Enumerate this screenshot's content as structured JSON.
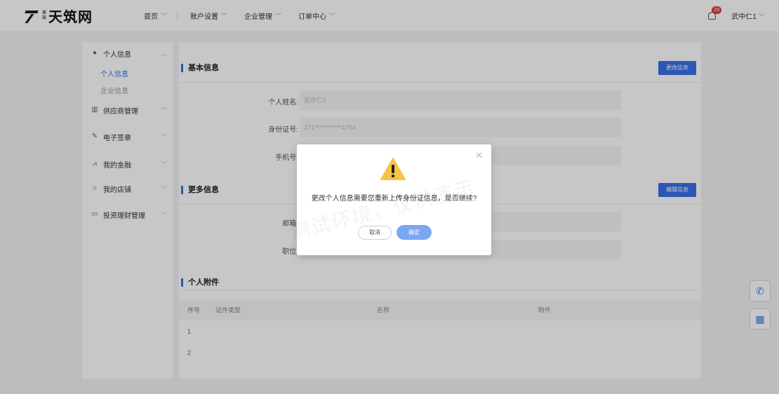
{
  "brand": {
    "logo_small_top": "天",
    "logo_small_bottom": "元",
    "name": "天筑网"
  },
  "nav": [
    {
      "label": "首页",
      "has_menu": true
    },
    {
      "label": "账户设置",
      "has_menu": true
    },
    {
      "label": "企业管理",
      "has_menu": true
    },
    {
      "label": "订单中心",
      "has_menu": true
    }
  ],
  "user": {
    "notification_count": "20",
    "name": "武中仁1"
  },
  "sidebar": {
    "personal_info": {
      "label": "个人信息",
      "icon": "user-icon",
      "expanded": true,
      "children": [
        {
          "label": "个人信息",
          "active": true
        },
        {
          "label": "企业信息",
          "active": false
        }
      ]
    },
    "groups": [
      {
        "label": "供应商管理",
        "icon": "bar-chart-icon"
      },
      {
        "label": "电子签章",
        "icon": "pen-icon"
      },
      {
        "label": "我的金融",
        "icon": "finance-chart-icon"
      },
      {
        "label": "我的店铺",
        "icon": "shop-icon"
      },
      {
        "label": "投资理财管理",
        "icon": "folder-icon"
      }
    ]
  },
  "basic": {
    "title": "基本信息",
    "edit_button": "更改信息",
    "name_label": "个人姓名:",
    "name_value": "武中仁1",
    "id_label": "身份证号:",
    "id_value": "371***********4754",
    "phone_label": "手机号:"
  },
  "more": {
    "title": "更多信息",
    "edit_button": "编辑信息",
    "email_label": "邮箱:",
    "position_label": "职位:"
  },
  "attachments": {
    "title": "个人附件",
    "columns": [
      "序号",
      "证件类型",
      "名称",
      "附件"
    ],
    "rows": [
      {
        "index": "1"
      },
      {
        "index": "2"
      }
    ]
  },
  "modal": {
    "message": "更改个人信息需要您重新上传身份证信息，是否继续?",
    "cancel": "取消",
    "confirm": "确定",
    "icon": "warning-icon",
    "warning_color": "#f6c443"
  },
  "watermark": "测试环境，仅供演示",
  "colors": {
    "accent": "#3a6fe8",
    "badge": "#e23c3c"
  }
}
